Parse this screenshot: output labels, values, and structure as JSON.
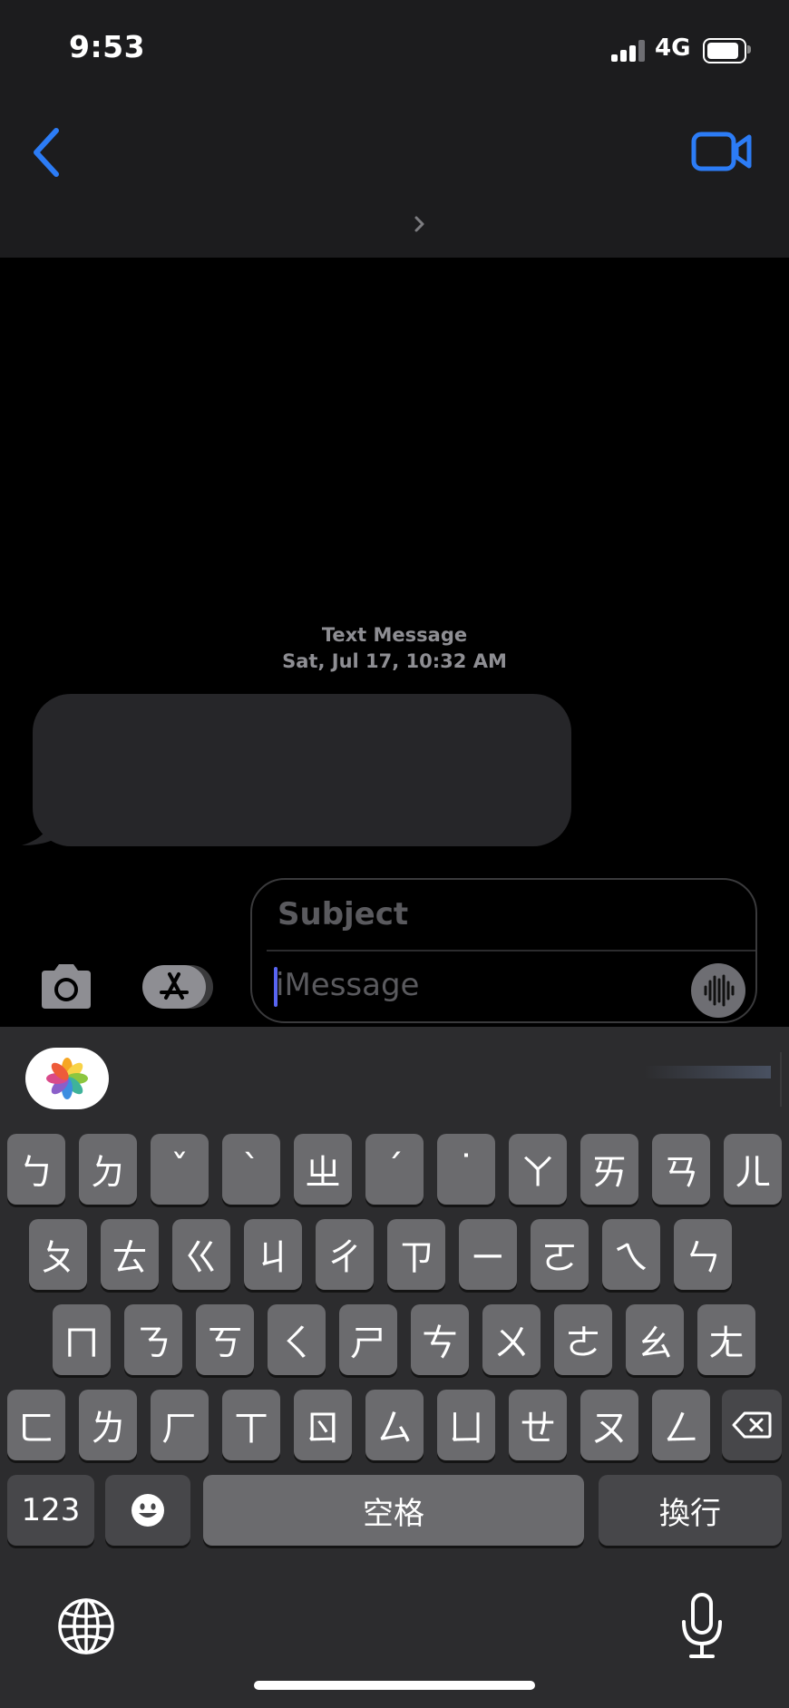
{
  "status_bar": {
    "time": "9:53",
    "network": "4G",
    "signal_bars": 3
  },
  "nav": {
    "back_icon": "chevron-left-icon",
    "video_icon": "video-camera-icon",
    "accent": "#2c7cf6"
  },
  "conversation": {
    "label": "Text Message",
    "timestamp": "Sat, Jul 17, 10:32 AM"
  },
  "composer": {
    "subject_placeholder": "Subject",
    "message_placeholder": "iMessage"
  },
  "keyboard": {
    "rows": [
      [
        "ㄅ",
        "ㄉ",
        "ˇ",
        "ˋ",
        "ㄓ",
        "ˊ",
        "˙",
        "ㄚ",
        "ㄞ",
        "ㄢ",
        "ㄦ"
      ],
      [
        "ㄆ",
        "ㄊ",
        "ㄍ",
        "ㄐ",
        "ㄔ",
        "ㄗ",
        "ㄧ",
        "ㄛ",
        "ㄟ",
        "ㄣ"
      ],
      [
        "ㄇ",
        "ㄋ",
        "ㄎ",
        "ㄑ",
        "ㄕ",
        "ㄘ",
        "ㄨ",
        "ㄜ",
        "ㄠ",
        "ㄤ"
      ],
      [
        "ㄈ",
        "ㄌ",
        "ㄏ",
        "ㄒ",
        "ㄖ",
        "ㄙ",
        "ㄩ",
        "ㄝ",
        "ㄡ",
        "ㄥ"
      ]
    ],
    "numbers_label": "123",
    "space_label": "空格",
    "return_label": "換行"
  }
}
